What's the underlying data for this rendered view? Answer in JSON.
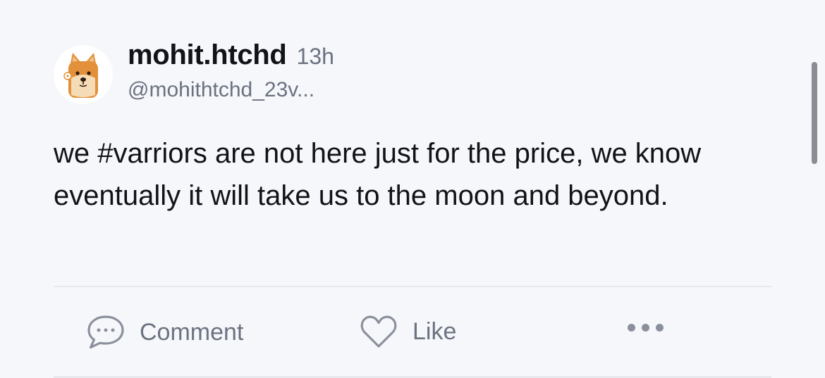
{
  "post": {
    "author": {
      "display_name": "mohit.htchd",
      "handle": "@mohithtchd_23v...",
      "avatar_icon": "doge-shiba-avatar"
    },
    "timestamp": "13h",
    "text": "we #varriors are not here just for the price, we know eventually it will take us to the moon and beyond."
  },
  "actions": {
    "comment": {
      "label": "Comment",
      "icon": "comment-bubble-icon"
    },
    "like": {
      "label": "Like",
      "icon": "heart-icon"
    },
    "more": {
      "icon": "more-horizontal-icon"
    }
  },
  "colors": {
    "background": "#f6f7fb",
    "text_primary": "#111318",
    "text_secondary": "#6b7280",
    "divider": "#e7e9ef",
    "avatar_orange": "#e2913a"
  }
}
